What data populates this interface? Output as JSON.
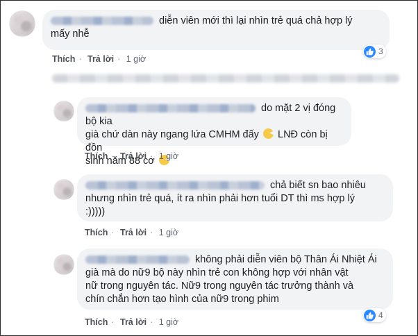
{
  "comments": [
    {
      "text_lines": [
        "diễn viên mới thì lại nhìn trẻ quá chả hợp lý",
        "mấy nhễ"
      ],
      "like": "Thích",
      "reply": "Trả lời",
      "time": "1 giờ",
      "reactions": "3"
    },
    {
      "text_lines": [
        "do mặt 2 vị đóng bộ kia",
        "già chứ dàn này ngang lứa CMHM đấy",
        "LNĐ còn bị đồn",
        "sinh năm 88 cơ"
      ],
      "like": "Thích",
      "reply": "Trả lời",
      "time": "1 giờ"
    },
    {
      "text_lines": [
        "chả biết sn bao nhiêu",
        "nhưng nhìn trẻ quá, ít ra nhìn phải hơn tuổi DT thì ms hợp lý",
        ":)))))"
      ],
      "like": "Thích",
      "reply": "Trả lời",
      "time": "1 giờ"
    },
    {
      "text_lines": [
        "không phải diễn viên bộ Thân Ái Nhiệt Ái",
        "già mà do nữ9 bộ này nhìn trẻ con không hợp với nhân vật",
        "nữ trong nguyên tác. Nữ9 trong nguyên tác trưởng thành và",
        "chín chắn hơn tạo hình của nữ9 trong phim"
      ],
      "like": "Thích",
      "reply": "Trả lời",
      "time": "1 giờ",
      "reactions": "4"
    }
  ],
  "icons": {
    "like": "thumbs-up-icon",
    "emoji": "pacman-emoji-icon"
  },
  "colors": {
    "bubble": "#f2f3f5",
    "like_blue": "#2d88ff",
    "meta_text": "#606770"
  }
}
